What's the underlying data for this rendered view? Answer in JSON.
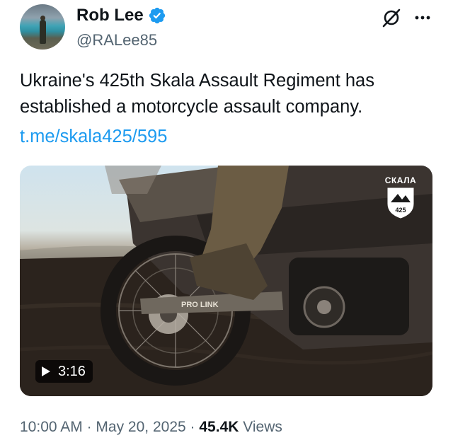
{
  "author": {
    "display_name": "Rob Lee",
    "handle": "@RALee85",
    "verified": true,
    "verified_color": "#1d9bf0"
  },
  "tweet": {
    "text_lines": [
      "Ukraine's 425th Skala Assault Regiment has",
      "established a motorcycle assault company."
    ],
    "link": "t.me/skala425/595",
    "link_color": "#1d9bf0"
  },
  "media": {
    "type": "video",
    "duration": "3:16",
    "overlay_brand": "СКАЛА",
    "overlay_number": "425",
    "overlay_text": "PRO LINK"
  },
  "meta": {
    "time": "10:00 AM",
    "separator": "·",
    "date": "May 20, 2025",
    "views_count": "45.4K",
    "views_label": "Views"
  },
  "icons": {
    "grok": "grok-icon",
    "more": "more-options-icon",
    "play": "play-icon",
    "verified": "verified-badge-icon"
  }
}
